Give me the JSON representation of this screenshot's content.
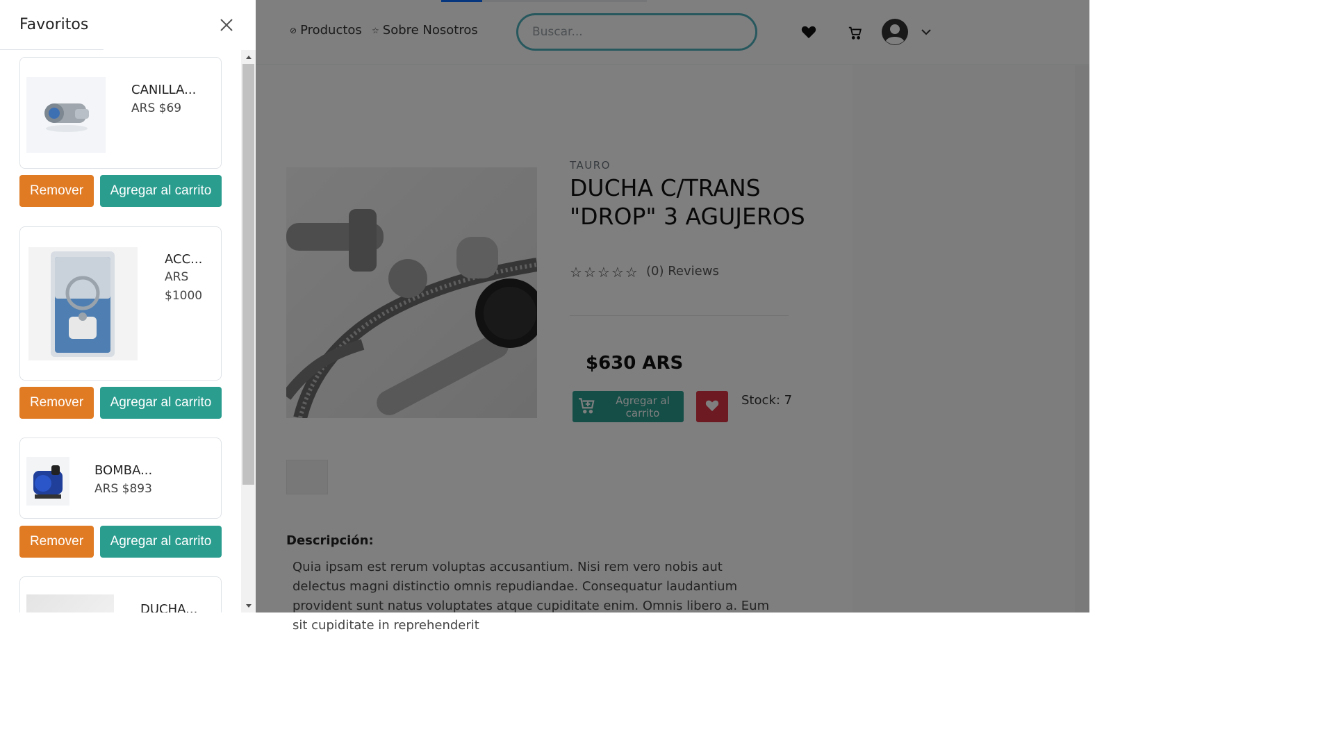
{
  "nav": {
    "productos": "Productos",
    "productos_icon": "compass-icon",
    "nosotros": "Sobre Nosotros",
    "nosotros_icon": "star-icon",
    "search_placeholder": "Buscar...",
    "load_progress": 0.2
  },
  "product": {
    "brand": "TAURO",
    "title": "DUCHA C/TRANS \"DROP\" 3 AGUJEROS",
    "rating": 0,
    "reviews": "(0) Reviews",
    "price": "$630 ARS",
    "add_to_cart": "Agregar al carrito",
    "stock": "Stock: 7",
    "description_title": "Descripción:",
    "description": "Quia ipsam est rerum voluptas accusantium. Nisi rem vero nobis aut delectus magni distinctio omnis repudiandae. Consequatur laudantium provident sunt natus voluptates atque cupiditate enim. Omnis libero a. Eum sit cupiditate in reprehenderit"
  },
  "favorites": {
    "title": "Favoritos",
    "items": [
      {
        "name": "CANILLA...",
        "price": "ARS $69",
        "remove": "Remover",
        "add": "Agregar al carrito"
      },
      {
        "name": "ACC...",
        "price": "ARS $1000",
        "remove": "Remover",
        "add": "Agregar al carrito"
      },
      {
        "name": "BOMBA...",
        "price": "ARS $893",
        "remove": "Remover",
        "add": "Agregar al carrito"
      },
      {
        "name": "DUCHA..."
      }
    ]
  },
  "colors": {
    "teal": "#2a9d8f",
    "orange": "#e07b24",
    "red": "#dc3545",
    "search_border": "#4fb0bd"
  }
}
